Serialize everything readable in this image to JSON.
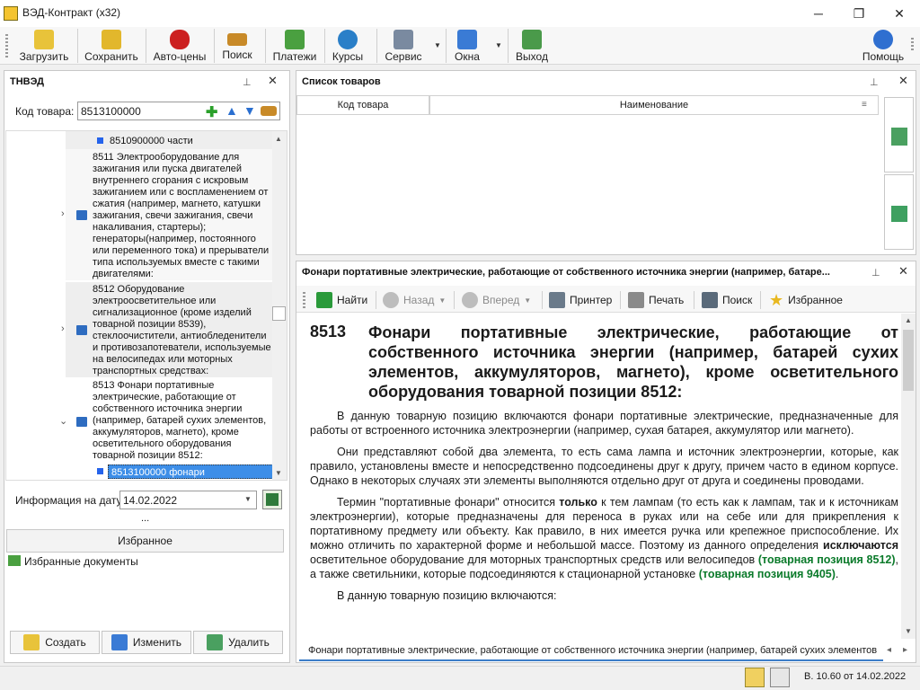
{
  "window": {
    "title": "ВЭД-Контракт (x32)",
    "min": "─",
    "max": "❐",
    "close": "✕"
  },
  "toolbar": {
    "items": [
      {
        "label": "Загрузить",
        "icon": "folder-open-icon",
        "color": "#e8c33a"
      },
      {
        "label": "Сохранить",
        "icon": "folder-save-icon",
        "color": "#e2b72c"
      },
      {
        "label": "Авто-цены",
        "icon": "car-icon",
        "color": "#cc2020"
      },
      {
        "label": "Поиск",
        "icon": "binoculars-icon",
        "color": "#c88a28"
      },
      {
        "label": "Платежи",
        "icon": "money-icon",
        "color": "#4aa040"
      },
      {
        "label": "Курсы",
        "icon": "currency-icon",
        "color": "#2a7fc8"
      },
      {
        "label": "Сервис",
        "icon": "tools-icon",
        "color": "#7a8aa0"
      },
      {
        "label": "Окна",
        "icon": "windows-icon",
        "color": "#3a7bd5"
      },
      {
        "label": "Выход",
        "icon": "exit-icon",
        "color": "#4a9a4a"
      },
      {
        "label": "Помощь",
        "icon": "help-icon",
        "color": "#2f6fd0"
      }
    ]
  },
  "tnved": {
    "title": "ТНВЭД",
    "code_label": "Код товара:",
    "code_value": "8513100000",
    "tree": [
      {
        "text": "8510900000 части"
      },
      {
        "text": "8511 Электрооборудование для зажигания или пуска двигателей внутреннего сгорания с искровым зажиганием или с воспламенением от сжатия (например, магнето, катушки зажигания, свечи зажигания, свечи накаливания, стартеры); генераторы(например, постоянного или переменного тока) и прерыватели типа используемых вместе с такими двигателями:"
      },
      {
        "text": "8512 Оборудование электроосветительное или сигнализационное (кроме изделий товарной позиции 8539), стеклоочистители, антиобледенители и противозапотеватели, используемые на велосипедах или моторных транспортных средствах:"
      },
      {
        "text": "8513 Фонари портативные электрические, работающие от собственного источника энергии (например, батарей сухих элементов, аккумуляторов, магнето), кроме осветительного оборудования товарной позиции 8512:"
      },
      {
        "text": "8513100000 фонари"
      }
    ],
    "date_label": "Информация на дату",
    "date_value": "14.02.2022",
    "ellipsis": "...",
    "fav_header": "Избранное",
    "fav_item": "Избранные документы",
    "btn_create": "Создать",
    "btn_edit": "Изменить",
    "btn_delete": "Удалить"
  },
  "goods": {
    "title": "Список товаров",
    "col_code": "Код товара",
    "col_name": "Наименование"
  },
  "doc": {
    "title": "Фонари портативные электрические, работающие от собственного источника энергии (например, батаре...",
    "nav": {
      "find": "Найти",
      "back": "Назад",
      "forward": "Вперед",
      "printer": "Принтер",
      "print": "Печать",
      "search": "Поиск",
      "favorites": "Избранное"
    },
    "heading_num": "8513",
    "heading_text": "Фонари портативные электрические, работающие от собственного источника энергии (например, батарей сухих элементов, аккумуляторов, магнето), кроме осветительного оборудования товарной позиции 8512:",
    "p1": "В данную товарную позицию включаются фонари портативные электрические, предназначенные для работы от встроенного источника электроэнергии (например, сухая батарея, аккумулятор или магнето).",
    "p2": "Они представляют собой два элемента, то есть сама лампа и источник электроэнергии, которые, как правило, установлены вместе и непосредственно подсоединены друг к другу, причем часто в едином корпусе. Однако в некоторых случаях эти элементы выполняются отдельно друг от друга и соединены проводами.",
    "p3a": "Термин \"портативные фонари\" относится ",
    "p3b": "только",
    "p3c": " к тем лампам (то есть как к лампам, так и к источникам электроэнергии), которые предназначены для переноса в руках или на себе или для прикрепления к портативному предмету или объекту. Как правило, в них имеется ручка или крепежное приспособление. Их можно отличить по характерной форме и небольшой массе. Поэтому из данного определения ",
    "p3d": "исключаются",
    "p3e": " осветительное оборудование для моторных транспортных средств или велосипедов ",
    "link1": "(товарная позиция 8512)",
    "p3f": ", а также светильники, которые подсоединяются к стационарной установке ",
    "link2": "(товарная позиция 9405)",
    "p3g": ".",
    "p4": "В данную товарную позицию включаются:",
    "tab": "Фонари портативные электрические, работающие от собственного источника энергии (например, батарей сухих элементов"
  },
  "status": {
    "version": "В. 10.60 от 14.02.2022"
  }
}
